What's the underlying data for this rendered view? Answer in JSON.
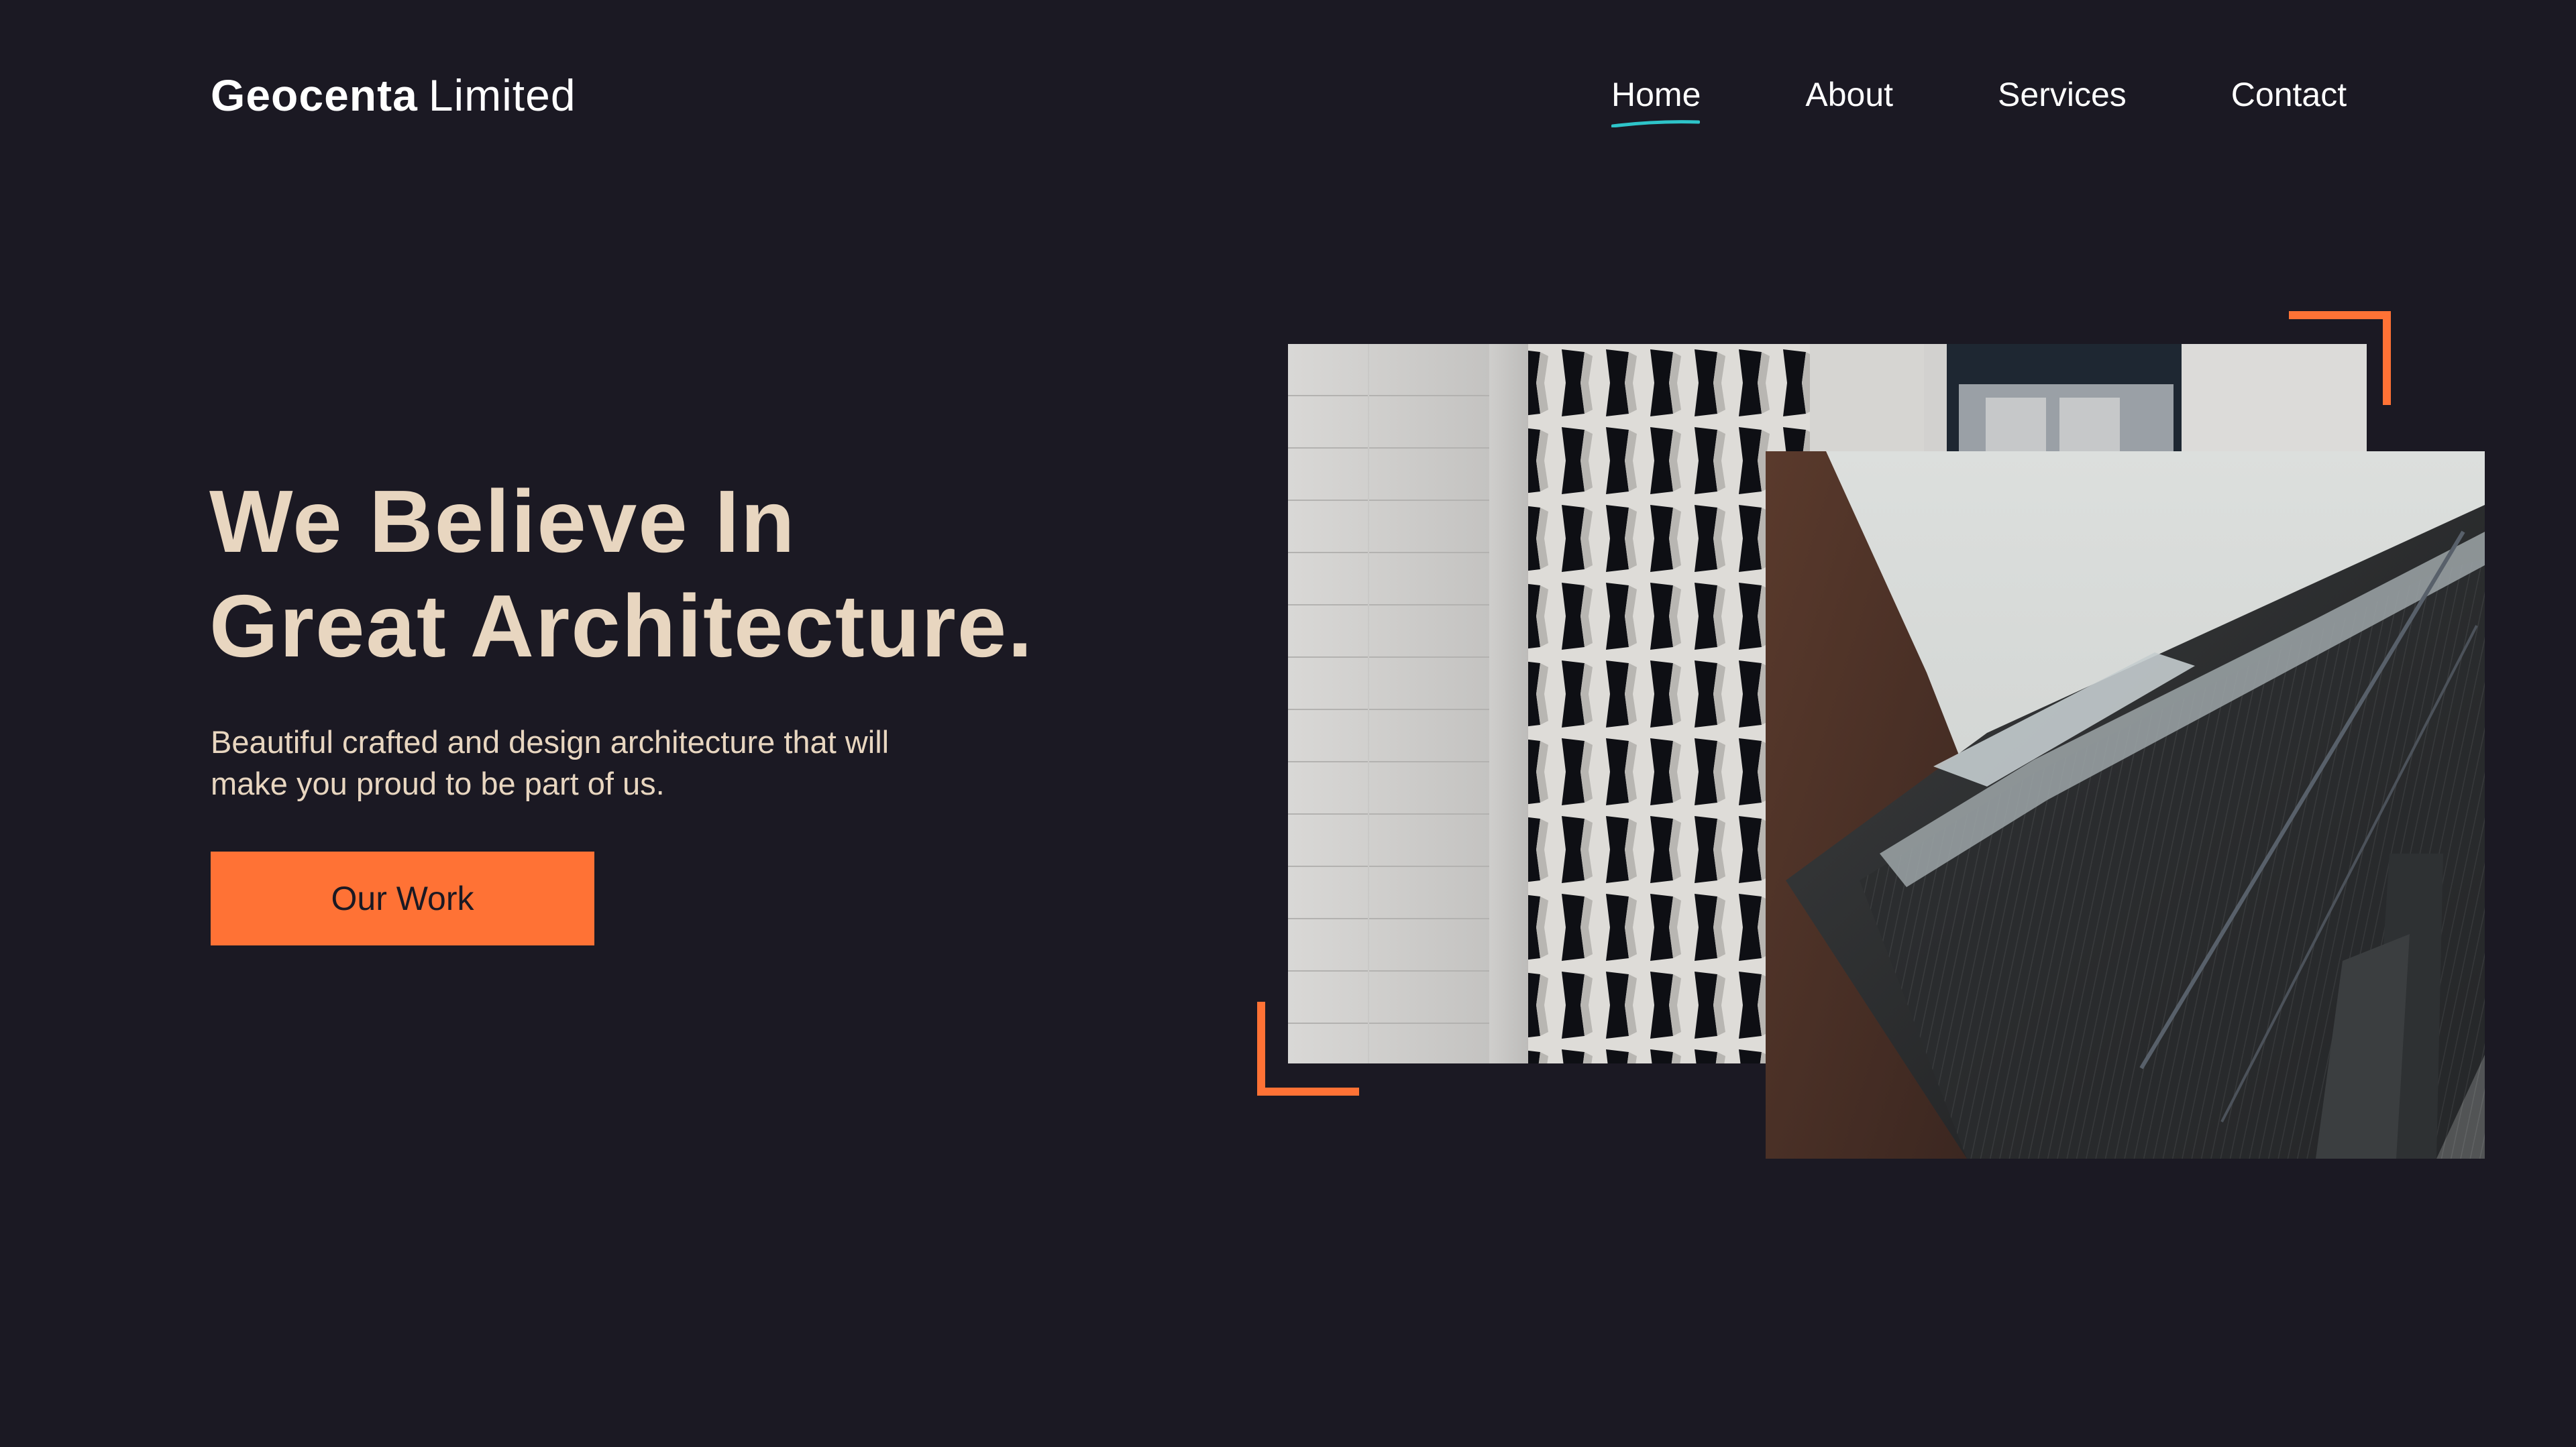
{
  "brand": {
    "name_bold": "Geocenta",
    "name_light": "Limited"
  },
  "nav": {
    "items": [
      {
        "label": "Home",
        "active": true
      },
      {
        "label": "About",
        "active": false
      },
      {
        "label": "Services",
        "active": false
      },
      {
        "label": "Contact",
        "active": false
      }
    ]
  },
  "hero": {
    "title_line1": "We Believe In",
    "title_line2": "Great Architecture.",
    "subtitle_line1": "Beautiful crafted and design architecture that will",
    "subtitle_line2": "make you proud to be part of us.",
    "cta_label": "Our Work"
  },
  "colors": {
    "background": "#1b1923",
    "accent": "#ff7235",
    "heading": "#e8d6c0",
    "nav_underline": "#2ec4c9",
    "text_light": "#ffffff"
  },
  "icons": {
    "frame_top_right": "corner-bracket-top-right",
    "frame_bottom_left": "corner-bracket-bottom-left"
  }
}
